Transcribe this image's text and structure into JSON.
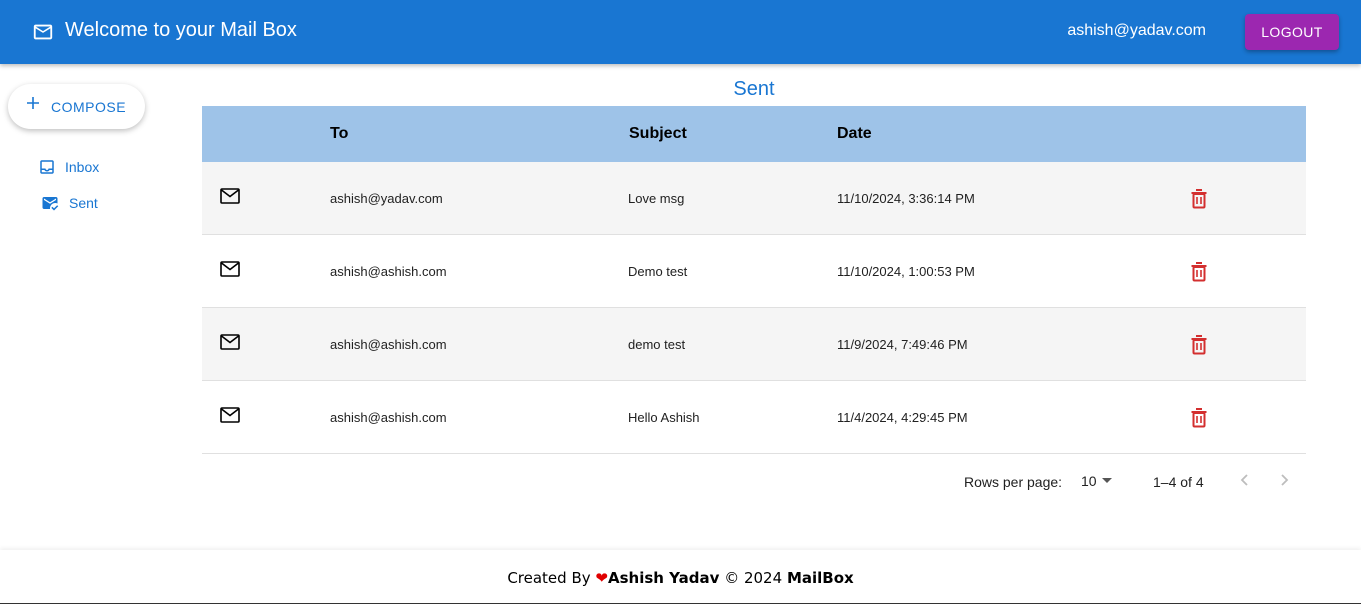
{
  "appbar": {
    "title": "Welcome to your Mail Box",
    "user_email": "ashish@yadav.com",
    "logout_label": "LOGOUT"
  },
  "sidebar": {
    "compose_label": "COMPOSE",
    "items": [
      {
        "label": "Inbox",
        "icon": "inbox-icon"
      },
      {
        "label": "Sent",
        "icon": "mark-email-read-icon"
      }
    ]
  },
  "main": {
    "heading": "Sent",
    "columns": [
      "To",
      "Subject",
      "Date"
    ],
    "rows": [
      {
        "to": "ashish@yadav.com",
        "subject": "Love msg",
        "date": "11/10/2024, 3:36:14 PM"
      },
      {
        "to": "ashish@ashish.com",
        "subject": "Demo test",
        "date": "11/10/2024, 1:00:53 PM"
      },
      {
        "to": "ashish@ashish.com",
        "subject": "demo test",
        "date": "11/9/2024, 7:49:46 PM"
      },
      {
        "to": "ashish@ashish.com",
        "subject": "Hello Ashish",
        "date": "11/4/2024, 4:29:45 PM"
      }
    ],
    "pagination": {
      "rows_per_page_label": "Rows per page:",
      "rows_per_page_value": "10",
      "range": "1–4 of 4"
    }
  },
  "footer": {
    "created_by": "Created By",
    "author": "Ashish Yadav",
    "copyright": "© 2024",
    "brand": "MailBox"
  },
  "colors": {
    "primary": "#1976d2",
    "logout": "#9c27b0",
    "table_header": "#9ec3e8",
    "delete": "#d32f2f",
    "heart": "#e00000"
  }
}
